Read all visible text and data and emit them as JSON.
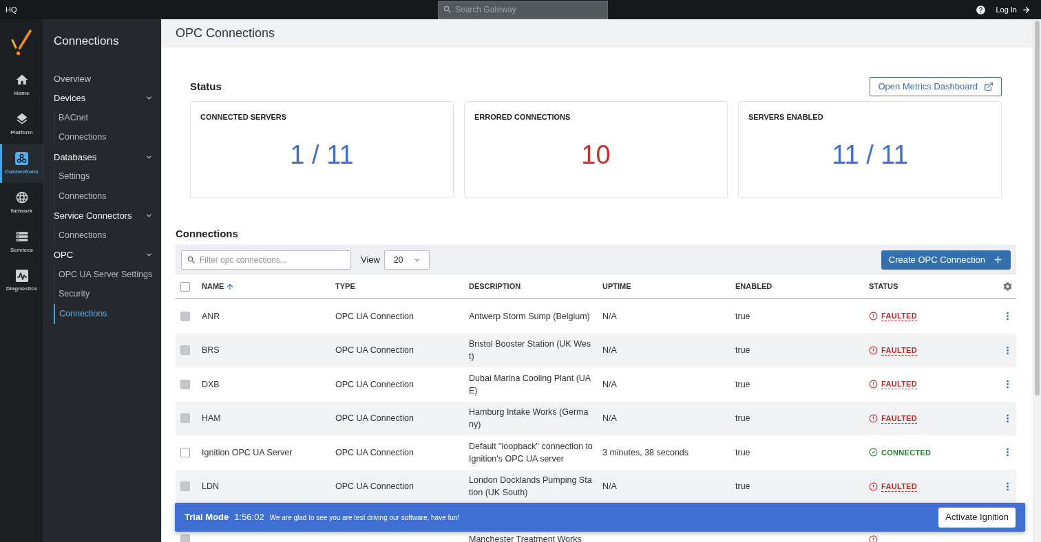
{
  "top_bar": {
    "title": "HQ",
    "search": {
      "placeholder": "Search Gateway"
    },
    "login": "Log In"
  },
  "rail": [
    {
      "label": "Home",
      "selected": false
    },
    {
      "label": "Platform",
      "selected": false
    },
    {
      "label": "Connections",
      "selected": true
    },
    {
      "label": "Network",
      "selected": false
    },
    {
      "label": "Services",
      "selected": false
    },
    {
      "label": "Diagnostics",
      "selected": false
    }
  ],
  "nav": {
    "title": "Connections",
    "items": [
      {
        "label": "Overview",
        "selected": false
      },
      {
        "label": "Devices",
        "expanded": true,
        "children": [
          {
            "label": "BACnet",
            "selected": false
          },
          {
            "label": "Connections",
            "selected": false
          }
        ]
      },
      {
        "label": "Databases",
        "expanded": true,
        "children": [
          {
            "label": "Settings",
            "selected": false
          },
          {
            "label": "Connections",
            "selected": false
          }
        ]
      },
      {
        "label": "Service Connectors",
        "expanded": true,
        "children": [
          {
            "label": "Connections",
            "selected": false
          }
        ]
      },
      {
        "label": "OPC",
        "expanded": true,
        "children": [
          {
            "label": "OPC UA Server Settings",
            "selected": false
          },
          {
            "label": "Security",
            "selected": false
          },
          {
            "label": "Connections",
            "selected": true
          }
        ]
      }
    ]
  },
  "page": {
    "title": "OPC Connections"
  },
  "status": {
    "heading": "Status",
    "metrics_button": "Open Metrics Dashboard",
    "cards": [
      {
        "label": "CONNECTED SERVERS",
        "value": "1 / 11",
        "color": "#3d6fcc"
      },
      {
        "label": "ERRORED CONNECTIONS",
        "value": "10",
        "color": "#c8322b"
      },
      {
        "label": "SERVERS ENABLED",
        "value": "11 / 11",
        "color": "#3d6fcc"
      }
    ]
  },
  "connections": {
    "heading": "Connections",
    "filter": {
      "placeholder": "Filter opc connections..."
    },
    "view_label": "View",
    "view_value": "20",
    "create_button": "Create OPC Connection",
    "select_all": {
      "checked": false
    },
    "columns": [
      {
        "label": "NAME",
        "sorted": true
      },
      {
        "label": "TYPE",
        "sorted": false
      },
      {
        "label": "DESCRIPTION",
        "sorted": false
      },
      {
        "label": "UPTIME",
        "sorted": false
      },
      {
        "label": "ENABLED",
        "sorted": false
      },
      {
        "label": "STATUS",
        "sorted": false
      }
    ],
    "rows": [
      {
        "checked": false,
        "disabled": true,
        "name": "ANR",
        "type": "OPC UA Connection",
        "description": "Antwerp Storm Sump (Belgium)",
        "uptime": "N/A",
        "enabled": "true",
        "status": {
          "label": "FAULTED",
          "kind": "faulted"
        }
      },
      {
        "checked": false,
        "disabled": true,
        "name": "BRS",
        "type": "OPC UA Connection",
        "description": "Bristol Booster Station (UK West)",
        "uptime": "N/A",
        "enabled": "true",
        "status": {
          "label": "FAULTED",
          "kind": "faulted"
        }
      },
      {
        "checked": false,
        "disabled": true,
        "name": "DXB",
        "type": "OPC UA Connection",
        "description": "Dubai Marina Cooling Plant (UAE)",
        "uptime": "N/A",
        "enabled": "true",
        "status": {
          "label": "FAULTED",
          "kind": "faulted"
        }
      },
      {
        "checked": false,
        "disabled": true,
        "name": "HAM",
        "type": "OPC UA Connection",
        "description": "Hamburg Intake Works (Germany)",
        "uptime": "N/A",
        "enabled": "true",
        "status": {
          "label": "FAULTED",
          "kind": "faulted"
        }
      },
      {
        "checked": false,
        "disabled": false,
        "name": "Ignition OPC UA Server",
        "type": "OPC UA Connection",
        "description": "Default \"loopback\" connection to Ignition's OPC UA server",
        "uptime": "3 minutes, 38 seconds",
        "enabled": "true",
        "status": {
          "label": "CONNECTED",
          "kind": "connected"
        }
      },
      {
        "checked": false,
        "disabled": true,
        "name": "LDN",
        "type": "OPC UA Connection",
        "description": "London Docklands Pumping Station (UK South)",
        "uptime": "N/A",
        "enabled": "true",
        "status": {
          "label": "FAULTED",
          "kind": "faulted"
        }
      },
      {
        "checked": false,
        "disabled": true,
        "description": "Manchester Treatment Works",
        "status": {
          "kind": "faulted"
        }
      }
    ]
  },
  "trial": {
    "title": "Trial Mode",
    "timer": "1:56:02",
    "message": "We are glad to see you are test driving our software, have fun!",
    "button": "Activate Ignition"
  }
}
